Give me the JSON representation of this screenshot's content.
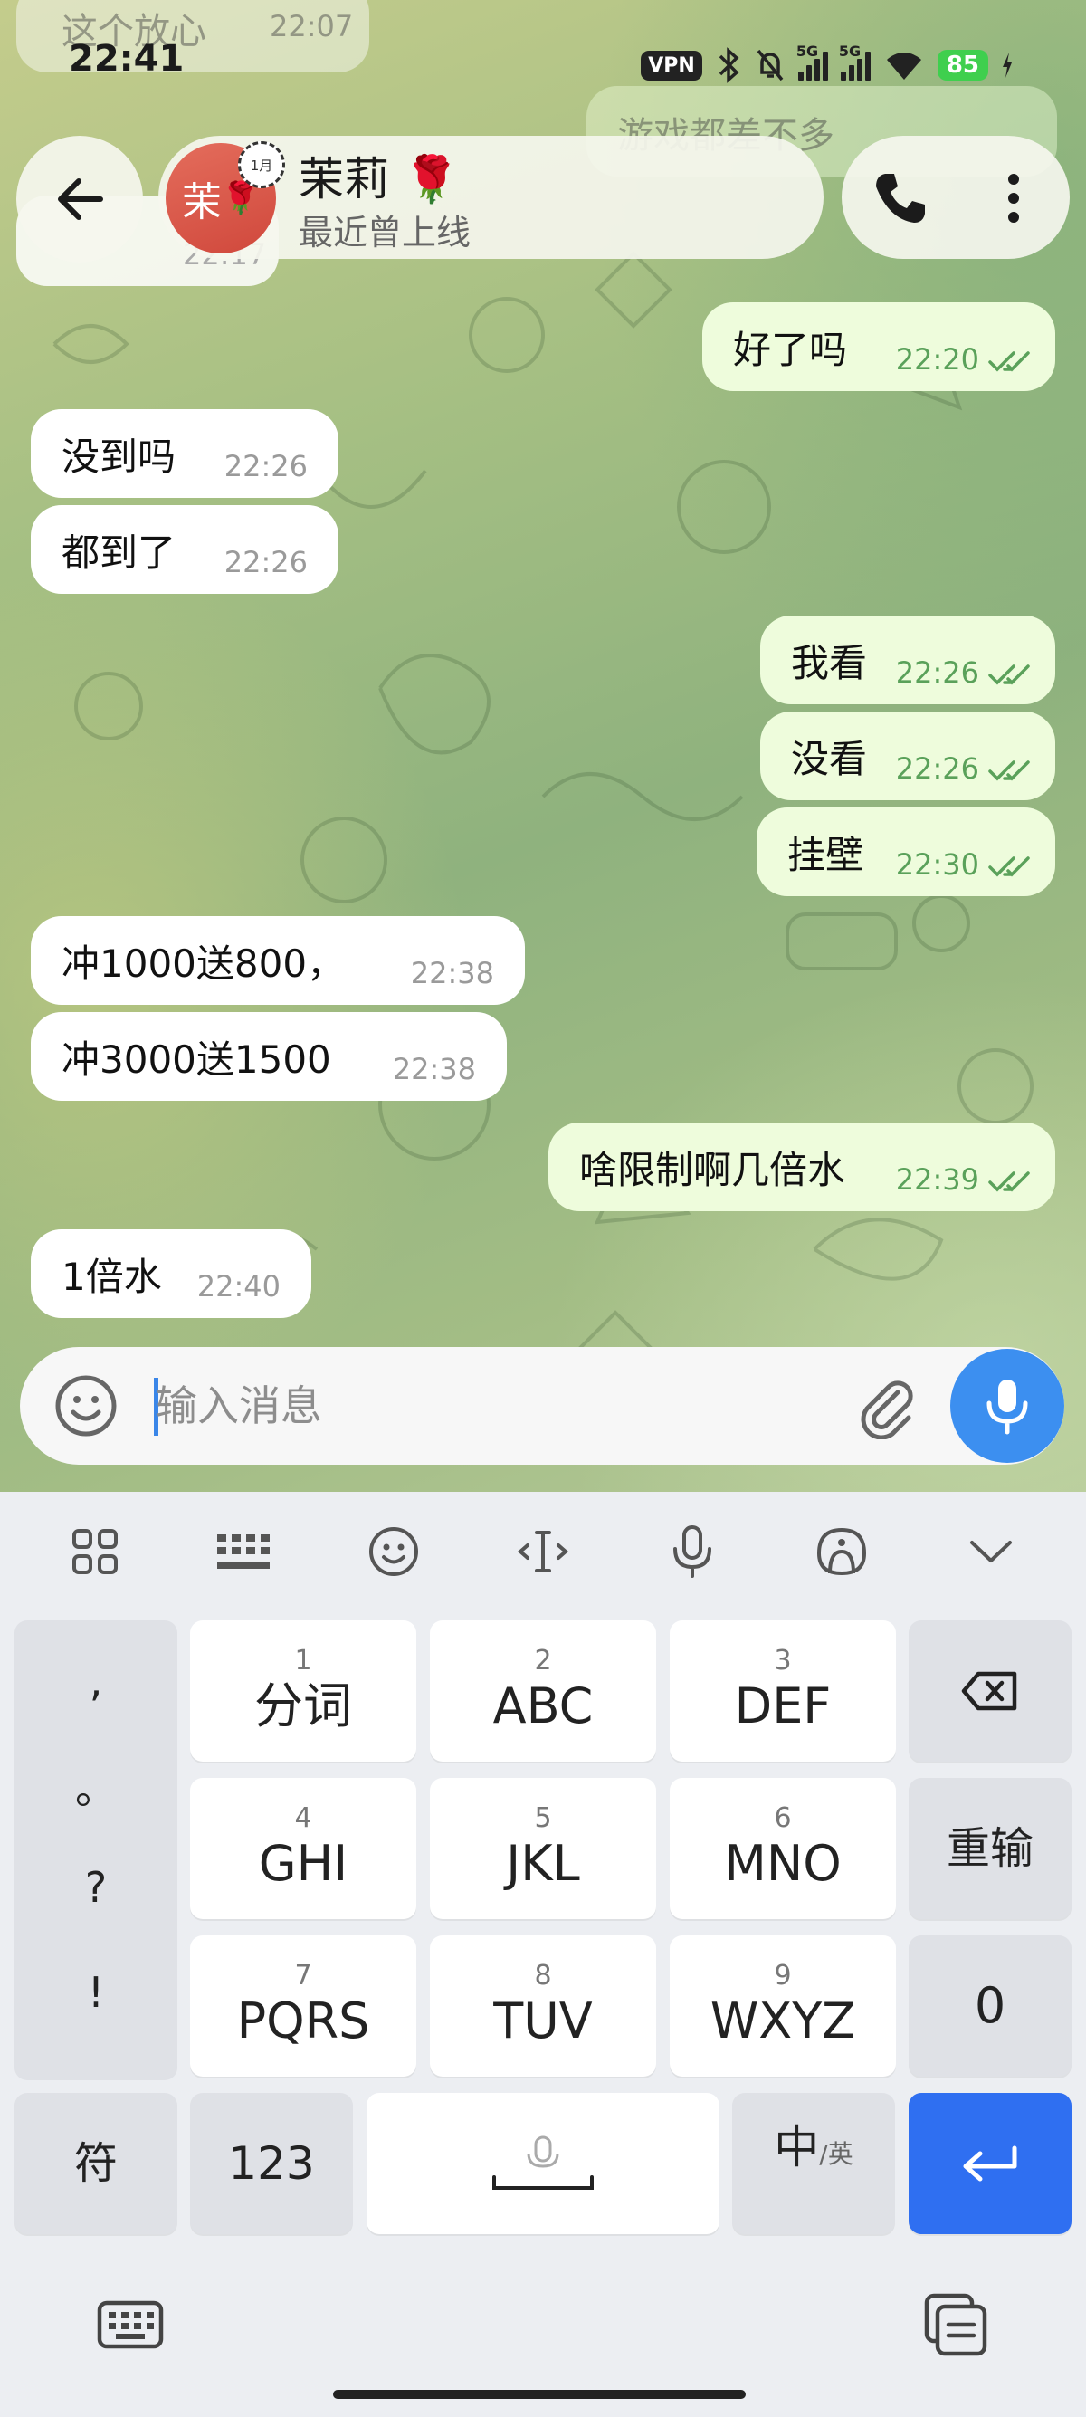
{
  "status_bar": {
    "time": "22:41",
    "vpn": "VPN",
    "net1": "5G",
    "net2": "5G",
    "battery": "85"
  },
  "ghost": {
    "top_left_text": "这个放心",
    "top_left_time": "22:07",
    "top_right_text": "游戏都差不多",
    "partial_left_time": "22:17"
  },
  "header": {
    "avatar_text": "茉",
    "story_badge": "1月",
    "name": "茉莉 🌹",
    "status": "最近曾上线"
  },
  "messages": [
    {
      "dir": "out",
      "text": "好了吗",
      "time": "22:20"
    },
    {
      "dir": "in",
      "text": "没到吗",
      "time": "22:26"
    },
    {
      "dir": "in",
      "text": "都到了",
      "time": "22:26"
    },
    {
      "dir": "out",
      "text": "我看",
      "time": "22:26"
    },
    {
      "dir": "out",
      "text": "没看",
      "time": "22:26"
    },
    {
      "dir": "out",
      "text": "挂壁",
      "time": "22:30"
    },
    {
      "dir": "in",
      "text": "冲1000送800，",
      "time": "22:38"
    },
    {
      "dir": "in",
      "text": "冲3000送1500",
      "time": "22:38"
    },
    {
      "dir": "out",
      "text": "啥限制啊几倍水",
      "time": "22:39"
    },
    {
      "dir": "in",
      "text": "1倍水",
      "time": "22:40"
    }
  ],
  "input": {
    "placeholder": "输入消息"
  },
  "keyboard": {
    "punct": [
      ",",
      "。",
      "?",
      "!"
    ],
    "keys": [
      {
        "num": "1",
        "label": "分词"
      },
      {
        "num": "2",
        "label": "ABC"
      },
      {
        "num": "3",
        "label": "DEF"
      },
      {
        "num": "4",
        "label": "GHI"
      },
      {
        "num": "5",
        "label": "JKL"
      },
      {
        "num": "6",
        "label": "MNO"
      },
      {
        "num": "7",
        "label": "PQRS"
      },
      {
        "num": "8",
        "label": "TUV"
      },
      {
        "num": "9",
        "label": "WXYZ"
      }
    ],
    "reenter": "重输",
    "zero": "0",
    "symbols": "符",
    "numbers": "123",
    "lang_main": "中",
    "lang_sub": "/英"
  },
  "colors": {
    "accent_blue": "#2f6ff1",
    "mic_blue": "#3c8ff0",
    "out_bubble": "#eefcdc",
    "check_green": "#5aa15a"
  }
}
